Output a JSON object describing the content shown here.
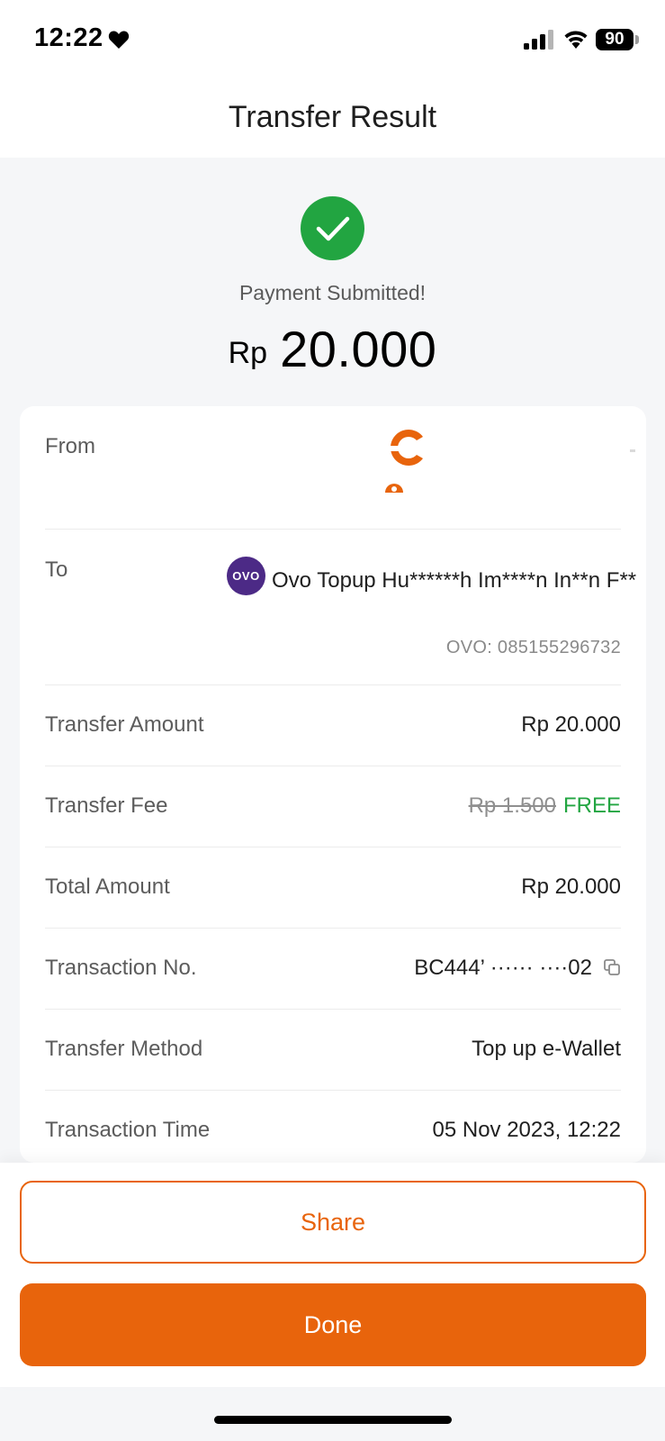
{
  "status_bar": {
    "time": "12:22",
    "heart_icon": "heart-icon",
    "signal_icon": "cellular-signal-icon",
    "wifi_icon": "wifi-icon",
    "battery_level": "90"
  },
  "header": {
    "title": "Transfer Result"
  },
  "result": {
    "icon": "check-circle-icon",
    "message": "Payment Submitted!",
    "currency": "Rp",
    "amount": "20.000"
  },
  "details": {
    "from_label": "From",
    "to_label": "To",
    "to_logo_text": "OVO",
    "to_name": "Ovo Topup Hu******h Im****n In**n F**",
    "to_account": "OVO: 085155296732",
    "rows": {
      "transfer_amount": {
        "label": "Transfer Amount",
        "value": "Rp 20.000"
      },
      "transfer_fee": {
        "label": "Transfer Fee",
        "original": "Rp 1.500",
        "value": "FREE"
      },
      "total_amount": {
        "label": "Total Amount",
        "value": "Rp 20.000"
      },
      "transaction_no": {
        "label": "Transaction No.",
        "value": "BC444’  ······            ····02"
      },
      "transfer_method": {
        "label": "Transfer Method",
        "value": "Top up e-Wallet"
      },
      "transaction_time": {
        "label": "Transaction Time",
        "value": "05 Nov 2023, 12:22"
      }
    }
  },
  "actions": {
    "share_label": "Share",
    "done_label": "Done"
  },
  "colors": {
    "accent": "#e8640c",
    "success": "#22a541",
    "ovo_purple": "#4c2a86"
  }
}
